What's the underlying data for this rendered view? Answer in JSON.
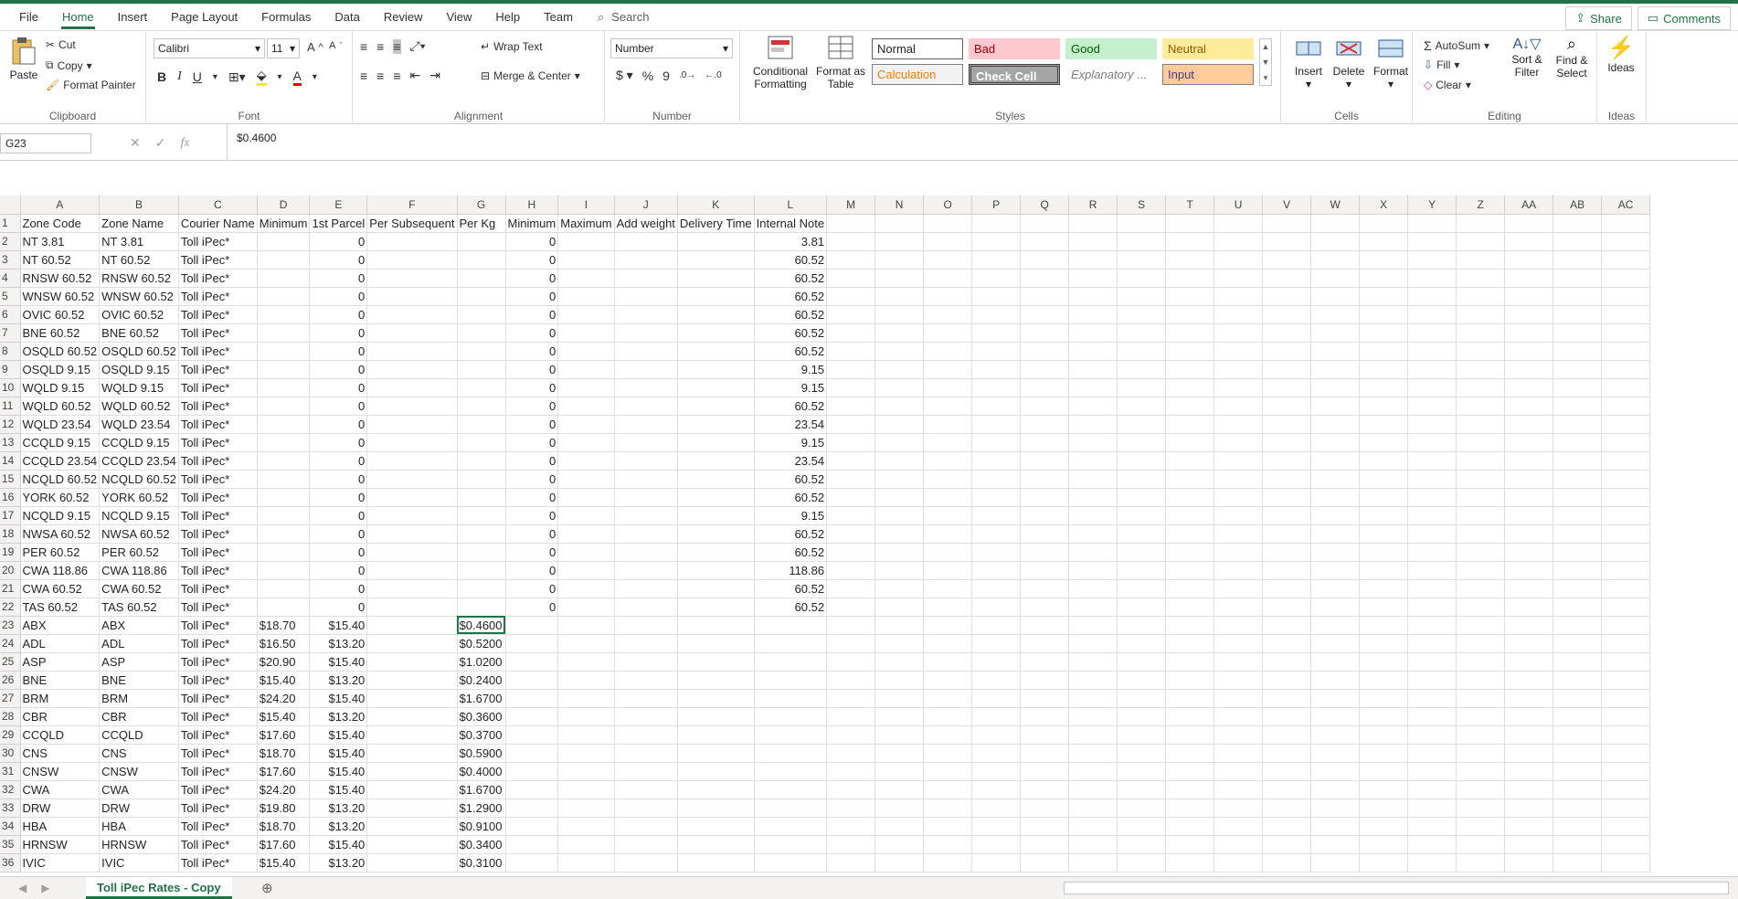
{
  "tabs": [
    "File",
    "Home",
    "Insert",
    "Page Layout",
    "Formulas",
    "Data",
    "Review",
    "View",
    "Help",
    "Team"
  ],
  "search": "Search",
  "share": "Share",
  "comments": "Comments",
  "clipboard": {
    "paste": "Paste",
    "cut": "Cut",
    "copy": "Copy",
    "format_painter": "Format Painter",
    "label": "Clipboard"
  },
  "font": {
    "name": "Calibri",
    "size": "11",
    "label": "Font"
  },
  "alignment": {
    "wrap": "Wrap Text",
    "merge": "Merge & Center",
    "label": "Alignment"
  },
  "number": {
    "format": "Number",
    "label": "Number"
  },
  "styles": {
    "cond1": "Conditional",
    "cond2": "Formatting",
    "fat1": "Format as",
    "fat2": "Table",
    "normal": "Normal",
    "bad": "Bad",
    "good": "Good",
    "neutral": "Neutral",
    "calculation": "Calculation",
    "check": "Check Cell",
    "explanatory": "Explanatory ...",
    "input": "Input",
    "label": "Styles"
  },
  "cells": {
    "insert": "Insert",
    "delete": "Delete",
    "format": "Format",
    "label": "Cells"
  },
  "editing": {
    "autosum": "AutoSum",
    "fill": "Fill",
    "clear": "Clear",
    "sort1": "Sort &",
    "sort2": "Filter",
    "find1": "Find &",
    "find2": "Select",
    "label": "Editing"
  },
  "ideas": {
    "label": "Ideas",
    "btn": "Ideas"
  },
  "namebox": "G23",
  "formula": "$0.4600",
  "columns": [
    "A",
    "B",
    "C",
    "D",
    "E",
    "F",
    "G",
    "H",
    "I",
    "J",
    "K",
    "L",
    "M",
    "N",
    "O",
    "P",
    "Q",
    "R",
    "S",
    "T",
    "U",
    "V",
    "W",
    "X",
    "Y",
    "Z",
    "AA",
    "AB",
    "AC"
  ],
  "rows": [
    [
      "1",
      "Zone Code",
      "Zone Name",
      "Courier Name",
      "Minimum",
      "1st Parcel",
      "Per Subsequent",
      "Per Kg",
      "Minimum",
      "Maximum",
      "Add weight",
      "Delivery Time",
      "Internal Note"
    ],
    [
      "2",
      "NT 3.81",
      "NT 3.81",
      "Toll iPec*",
      "",
      "0",
      "",
      "",
      "0",
      "",
      "",
      "",
      "3.81"
    ],
    [
      "3",
      "NT 60.52",
      "NT 60.52",
      "Toll iPec*",
      "",
      "0",
      "",
      "",
      "0",
      "",
      "",
      "",
      "60.52"
    ],
    [
      "4",
      "RNSW 60.52",
      "RNSW 60.52",
      "Toll iPec*",
      "",
      "0",
      "",
      "",
      "0",
      "",
      "",
      "",
      "60.52"
    ],
    [
      "5",
      "WNSW 60.52",
      "WNSW 60.52",
      "Toll iPec*",
      "",
      "0",
      "",
      "",
      "0",
      "",
      "",
      "",
      "60.52"
    ],
    [
      "6",
      "OVIC 60.52",
      "OVIC 60.52",
      "Toll iPec*",
      "",
      "0",
      "",
      "",
      "0",
      "",
      "",
      "",
      "60.52"
    ],
    [
      "7",
      "BNE 60.52",
      "BNE 60.52",
      "Toll iPec*",
      "",
      "0",
      "",
      "",
      "0",
      "",
      "",
      "",
      "60.52"
    ],
    [
      "8",
      "OSQLD 60.52",
      "OSQLD 60.52",
      "Toll iPec*",
      "",
      "0",
      "",
      "",
      "0",
      "",
      "",
      "",
      "60.52"
    ],
    [
      "9",
      "OSQLD 9.15",
      "OSQLD 9.15",
      "Toll iPec*",
      "",
      "0",
      "",
      "",
      "0",
      "",
      "",
      "",
      "9.15"
    ],
    [
      "10",
      "WQLD 9.15",
      "WQLD 9.15",
      "Toll iPec*",
      "",
      "0",
      "",
      "",
      "0",
      "",
      "",
      "",
      "9.15"
    ],
    [
      "11",
      "WQLD 60.52",
      "WQLD 60.52",
      "Toll iPec*",
      "",
      "0",
      "",
      "",
      "0",
      "",
      "",
      "",
      "60.52"
    ],
    [
      "12",
      "WQLD 23.54",
      "WQLD 23.54",
      "Toll iPec*",
      "",
      "0",
      "",
      "",
      "0",
      "",
      "",
      "",
      "23.54"
    ],
    [
      "13",
      "CCQLD 9.15",
      "CCQLD 9.15",
      "Toll iPec*",
      "",
      "0",
      "",
      "",
      "0",
      "",
      "",
      "",
      "9.15"
    ],
    [
      "14",
      "CCQLD 23.54",
      "CCQLD 23.54",
      "Toll iPec*",
      "",
      "0",
      "",
      "",
      "0",
      "",
      "",
      "",
      "23.54"
    ],
    [
      "15",
      "NCQLD 60.52",
      "NCQLD 60.52",
      "Toll iPec*",
      "",
      "0",
      "",
      "",
      "0",
      "",
      "",
      "",
      "60.52"
    ],
    [
      "16",
      "YORK 60.52",
      "YORK 60.52",
      "Toll iPec*",
      "",
      "0",
      "",
      "",
      "0",
      "",
      "",
      "",
      "60.52"
    ],
    [
      "17",
      "NCQLD 9.15",
      "NCQLD 9.15",
      "Toll iPec*",
      "",
      "0",
      "",
      "",
      "0",
      "",
      "",
      "",
      "9.15"
    ],
    [
      "18",
      "NWSA 60.52",
      "NWSA 60.52",
      "Toll iPec*",
      "",
      "0",
      "",
      "",
      "0",
      "",
      "",
      "",
      "60.52"
    ],
    [
      "19",
      "PER 60.52",
      "PER 60.52",
      "Toll iPec*",
      "",
      "0",
      "",
      "",
      "0",
      "",
      "",
      "",
      "60.52"
    ],
    [
      "20",
      "CWA 118.86",
      "CWA 118.86",
      "Toll iPec*",
      "",
      "0",
      "",
      "",
      "0",
      "",
      "",
      "",
      "118.86"
    ],
    [
      "21",
      "CWA 60.52",
      "CWA 60.52",
      "Toll iPec*",
      "",
      "0",
      "",
      "",
      "0",
      "",
      "",
      "",
      "60.52"
    ],
    [
      "22",
      "TAS 60.52",
      "TAS 60.52",
      "Toll iPec*",
      "",
      "0",
      "",
      "",
      "0",
      "",
      "",
      "",
      "60.52"
    ],
    [
      "23",
      "ABX",
      "ABX",
      "Toll iPec*",
      "$18.70",
      "$15.40",
      "",
      "$0.4600",
      "",
      "",
      "",
      "",
      ""
    ],
    [
      "24",
      "ADL",
      "ADL",
      "Toll iPec*",
      "$16.50",
      "$13.20",
      "",
      "$0.5200",
      "",
      "",
      "",
      "",
      ""
    ],
    [
      "25",
      "ASP",
      "ASP",
      "Toll iPec*",
      "$20.90",
      "$15.40",
      "",
      "$1.0200",
      "",
      "",
      "",
      "",
      ""
    ],
    [
      "26",
      "BNE",
      "BNE",
      "Toll iPec*",
      "$15.40",
      "$13.20",
      "",
      "$0.2400",
      "",
      "",
      "",
      "",
      ""
    ],
    [
      "27",
      "BRM",
      "BRM",
      "Toll iPec*",
      "$24.20",
      "$15.40",
      "",
      "$1.6700",
      "",
      "",
      "",
      "",
      ""
    ],
    [
      "28",
      "CBR",
      "CBR",
      "Toll iPec*",
      "$15.40",
      "$13.20",
      "",
      "$0.3600",
      "",
      "",
      "",
      "",
      ""
    ],
    [
      "29",
      "CCQLD",
      "CCQLD",
      "Toll iPec*",
      "$17.60",
      "$15.40",
      "",
      "$0.3700",
      "",
      "",
      "",
      "",
      ""
    ],
    [
      "30",
      "CNS",
      "CNS",
      "Toll iPec*",
      "$18.70",
      "$15.40",
      "",
      "$0.5900",
      "",
      "",
      "",
      "",
      ""
    ],
    [
      "31",
      "CNSW",
      "CNSW",
      "Toll iPec*",
      "$17.60",
      "$15.40",
      "",
      "$0.4000",
      "",
      "",
      "",
      "",
      ""
    ],
    [
      "32",
      "CWA",
      "CWA",
      "Toll iPec*",
      "$24.20",
      "$15.40",
      "",
      "$1.6700",
      "",
      "",
      "",
      "",
      ""
    ],
    [
      "33",
      "DRW",
      "DRW",
      "Toll iPec*",
      "$19.80",
      "$13.20",
      "",
      "$1.2900",
      "",
      "",
      "",
      "",
      ""
    ],
    [
      "34",
      "HBA",
      "HBA",
      "Toll iPec*",
      "$18.70",
      "$13.20",
      "",
      "$0.9100",
      "",
      "",
      "",
      "",
      ""
    ],
    [
      "35",
      "HRNSW",
      "HRNSW",
      "Toll iPec*",
      "$17.60",
      "$15.40",
      "",
      "$0.3400",
      "",
      "",
      "",
      "",
      ""
    ],
    [
      "36",
      "IVIC",
      "IVIC",
      "Toll iPec*",
      "$15.40",
      "$13.20",
      "",
      "$0.3100",
      "",
      "",
      "",
      "",
      ""
    ]
  ],
  "sheet_tab": "Toll iPec Rates - Copy"
}
